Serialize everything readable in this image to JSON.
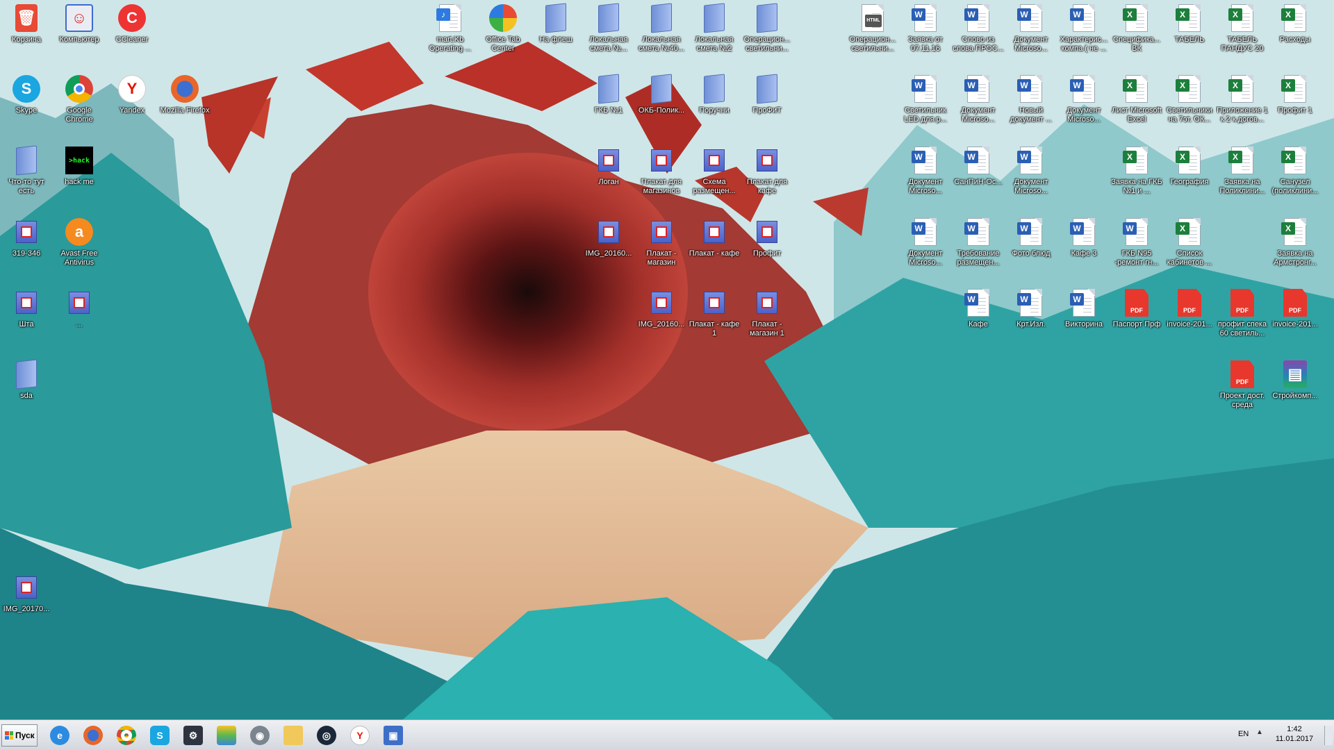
{
  "colors": {
    "taskbar": "#dde1e6",
    "word": "#2b5fb4",
    "excel": "#1d7f3c",
    "pdf": "#e8372c"
  },
  "desktop": {
    "icons": [
      {
        "label": "Корзина",
        "type": "trash-icon"
      },
      {
        "label": "Компьютер",
        "type": "computer-icon"
      },
      {
        "label": "CCleaner",
        "type": "ccleaner-icon"
      },
      {
        "label": "Skype",
        "type": "skype-icon"
      },
      {
        "label": "Google Chrome",
        "type": "chrome-icon"
      },
      {
        "label": "Yandex",
        "type": "yandex-icon"
      },
      {
        "label": "Mozilla Firefox",
        "type": "firefox-icon"
      },
      {
        "label": "Что-то тут есть",
        "type": "folder-icon"
      },
      {
        "label": "hack me",
        "type": "hackme-icon"
      },
      {
        "label": "319-346",
        "type": "image-icon"
      },
      {
        "label": "Avast Free Antivirus",
        "type": "avast-icon"
      },
      {
        "label": "Шта",
        "type": "image-icon"
      },
      {
        "label": "...",
        "type": "image-icon"
      },
      {
        "label": "sda",
        "type": "folder-icon"
      },
      {
        "label": "IMG_20170...",
        "type": "image-icon"
      },
      {
        "label": "mart.Kb Operating ...",
        "type": "audio-doc-icon"
      },
      {
        "label": "Office Tab Center",
        "type": "office-tab-icon"
      },
      {
        "label": "На флеш",
        "type": "folder-icon"
      },
      {
        "label": "Локальная смета №...",
        "type": "folder-icon"
      },
      {
        "label": "Локальная смета №40...",
        "type": "folder-icon"
      },
      {
        "label": "Локальная смета №2",
        "type": "folder-icon"
      },
      {
        "label": "Операцион... светильни...",
        "type": "folder-icon"
      },
      {
        "label": "ГКБ №1",
        "type": "folder-icon"
      },
      {
        "label": "ОКБ-Полик...",
        "type": "folder-icon"
      },
      {
        "label": "Поручни",
        "type": "folder-icon"
      },
      {
        "label": "ПроФиТ",
        "type": "folder-icon"
      },
      {
        "label": "Логан",
        "type": "image-icon"
      },
      {
        "label": "Плакат для магазинов",
        "type": "image-icon"
      },
      {
        "label": "Схема размещен...",
        "type": "image-icon"
      },
      {
        "label": "Плакат для кафе",
        "type": "image-icon"
      },
      {
        "label": "IMG_20160...",
        "type": "image-icon"
      },
      {
        "label": "Плакат - магазин",
        "type": "image-icon"
      },
      {
        "label": "Плакат - кафе",
        "type": "image-icon"
      },
      {
        "label": "Профит",
        "type": "image-icon"
      },
      {
        "label": "IMG_20160...",
        "type": "image-icon"
      },
      {
        "label": "Плакат - кафе 1",
        "type": "image-icon"
      },
      {
        "label": "Плакат - магазин 1",
        "type": "image-icon"
      },
      {
        "label": "Операцион... светильни...",
        "type": "html-doc-icon"
      },
      {
        "label": "Заявка от 07.11.16",
        "type": "word-doc-icon"
      },
      {
        "label": "Слово из слова ПРОС...",
        "type": "word-doc-icon"
      },
      {
        "label": "Документ Microso...",
        "type": "word-doc-icon"
      },
      {
        "label": "Характерис... компа ( не ...",
        "type": "word-doc-icon"
      },
      {
        "label": "Специфика... ВК",
        "type": "excel-doc-icon"
      },
      {
        "label": "ТАБЕЛЬ",
        "type": "excel-doc-icon"
      },
      {
        "label": "ТАБЕЛЬ ПАНДУС 20",
        "type": "excel-doc-icon"
      },
      {
        "label": "Расходы",
        "type": "excel-doc-icon"
      },
      {
        "label": "Светильник LED для р...",
        "type": "word-doc-icon"
      },
      {
        "label": "Документ Microso...",
        "type": "word-doc-icon"
      },
      {
        "label": "Новый документ ...",
        "type": "word-doc-icon"
      },
      {
        "label": "Документ Microso...",
        "type": "word-doc-icon"
      },
      {
        "label": "Лист Microsoft Excel",
        "type": "excel-doc-icon"
      },
      {
        "label": "Светильники на 7эт. ОК...",
        "type": "excel-doc-icon"
      },
      {
        "label": "Приложение 1 к 2 к догов...",
        "type": "excel-doc-icon"
      },
      {
        "label": "Профит 1",
        "type": "excel-doc-icon"
      },
      {
        "label": "Документ Microso...",
        "type": "word-doc-icon"
      },
      {
        "label": "СанПиН-Ос...",
        "type": "word-doc-icon"
      },
      {
        "label": "Документ Microso...",
        "type": "word-doc-icon"
      },
      {
        "label": "Заявка на ГКБ №1 и ...",
        "type": "excel-doc-icon"
      },
      {
        "label": "География",
        "type": "excel-doc-icon"
      },
      {
        "label": "Заявка на Поликлини...",
        "type": "excel-doc-icon"
      },
      {
        "label": "Санузел (поликлини...",
        "type": "excel-doc-icon"
      },
      {
        "label": "Документ Microso...",
        "type": "word-doc-icon"
      },
      {
        "label": "Требование размещен...",
        "type": "word-doc-icon"
      },
      {
        "label": "Фото блюд",
        "type": "word-doc-icon"
      },
      {
        "label": "Кафе 3",
        "type": "word-doc-icon"
      },
      {
        "label": "ГКБ N95 -ремонт гн...",
        "type": "word-doc-icon"
      },
      {
        "label": "Список кабинетов ...",
        "type": "excel-doc-icon"
      },
      {
        "label": "Заявка на Армстронг...",
        "type": "excel-doc-icon"
      },
      {
        "label": "Кафе",
        "type": "word-doc-icon"
      },
      {
        "label": "Крт.Изл.",
        "type": "word-doc-icon"
      },
      {
        "label": "Викторина",
        "type": "word-doc-icon"
      },
      {
        "label": "Паспорт Прф",
        "type": "pdf-icon"
      },
      {
        "label": "invoice-201...",
        "type": "pdf-icon"
      },
      {
        "label": "профит спека 60 светиль...",
        "type": "pdf-icon"
      },
      {
        "label": "invoice-201...",
        "type": "pdf-icon"
      },
      {
        "label": "Проект дост. среда",
        "type": "pdf-icon"
      },
      {
        "label": "Стройкомп...",
        "type": "winrar-icon"
      }
    ]
  },
  "taskbar": {
    "start_label": "Пуск",
    "pinned": [
      "internet-explorer-icon",
      "firefox-icon",
      "chrome-icon",
      "skype-icon",
      "shield-app-icon",
      "bluestacks-icon",
      "steam-like-icon",
      "file-explorer-icon",
      "steam-icon",
      "yandex-icon",
      "network-app-icon"
    ],
    "language": "EN",
    "time": "1:42",
    "date": "11.01.2017"
  }
}
